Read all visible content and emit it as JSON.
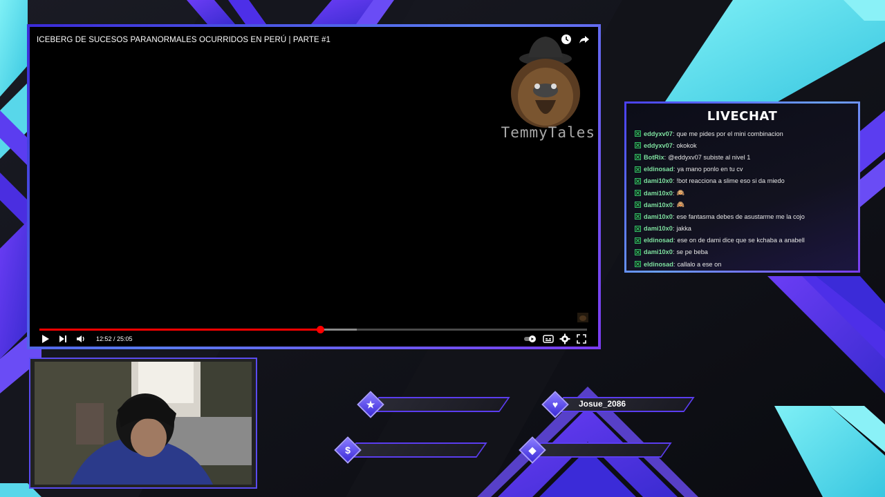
{
  "video": {
    "title": "ICEBERG DE SUCESOS PARANORMALES OCURRIDOS EN PERÚ | PARTE #1",
    "channel_name": "TemmyTales",
    "current_time": "12:52",
    "duration": "25:05",
    "time_display": "12:52 / 25:05",
    "progress_fraction": 0.513,
    "buffered_fraction": 0.58,
    "top_icons": [
      "watch-later-icon",
      "share-icon"
    ],
    "controls": [
      "play-icon",
      "next-icon",
      "volume-icon",
      "autoplay-toggle-icon",
      "subtitles-icon",
      "settings-icon",
      "fullscreen-icon"
    ]
  },
  "chat": {
    "title": "LIVECHAT",
    "messages": [
      {
        "user": "eddyxv07",
        "text": "que me pides por el mini combinacion"
      },
      {
        "user": "eddyxv07",
        "text": "okokok"
      },
      {
        "user": "BotRix",
        "text": "@eddyxv07 subiste al nivel 1"
      },
      {
        "user": "eldinosad",
        "text": "ya mano ponlo en tu cv"
      },
      {
        "user": "dami10x0",
        "text": "!bot reacciona a slime eso si da miedo"
      },
      {
        "user": "dami10x0",
        "text": "🙉"
      },
      {
        "user": "dami10x0",
        "text": "🙈"
      },
      {
        "user": "dami10x0",
        "text": "ese fantasma debes de asustarme me la cojo"
      },
      {
        "user": "dami10x0",
        "text": "jakka"
      },
      {
        "user": "eldinosad",
        "text": "ese on de dami dice que se kchaba a anabell"
      },
      {
        "user": "dami10x0",
        "text": "se pe beba"
      },
      {
        "user": "eldinosad",
        "text": "callalo a ese on"
      }
    ]
  },
  "stats": {
    "follower": {
      "icon": "star-icon",
      "label": ""
    },
    "subscriber": {
      "icon": "heart-icon",
      "label": "Josue_2086"
    },
    "donation": {
      "icon": "dollar-icon",
      "label": ""
    },
    "bits": {
      "icon": "gem-icon",
      "label": ""
    }
  },
  "colors": {
    "accent_purple": "#5b3df0",
    "accent_cyan": "#58d7ea",
    "progress_red": "#ff0000",
    "chat_user_green": "#7fe1a0"
  }
}
